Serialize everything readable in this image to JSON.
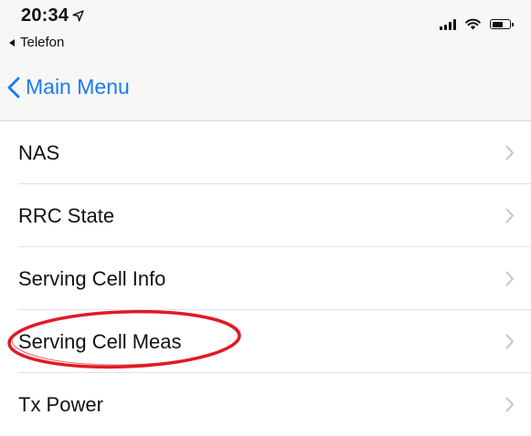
{
  "status_bar": {
    "time": "20:34",
    "back_to_app": "Telefon",
    "battery_level": 0.7
  },
  "nav": {
    "back_label": "Main Menu"
  },
  "menu": {
    "items": [
      {
        "label": "NAS"
      },
      {
        "label": "RRC State"
      },
      {
        "label": "Serving Cell Info"
      },
      {
        "label": "Serving Cell Meas"
      },
      {
        "label": "Tx Power"
      }
    ]
  },
  "colors": {
    "accent": "#1a7cf5",
    "highlight_ring": "#e01b24"
  }
}
